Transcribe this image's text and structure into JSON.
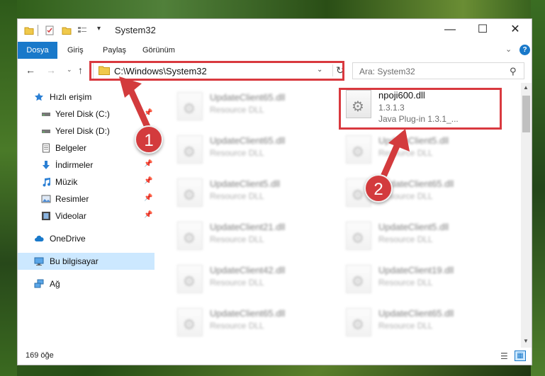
{
  "window": {
    "title": "System32",
    "controls": {
      "minimize": "—",
      "maximize": "☐",
      "close": "✕"
    }
  },
  "ribbon": {
    "tabs": [
      "Dosya",
      "Giriş",
      "Paylaş",
      "Görünüm"
    ],
    "active_tab": "Dosya",
    "help": "?"
  },
  "navigation": {
    "back": "←",
    "forward": "→",
    "history": "⌄",
    "up": "↑",
    "address": "C:\\Windows\\System32",
    "search_placeholder": "Ara: System32"
  },
  "sidebar": {
    "items": [
      {
        "label": "Hızlı erişim",
        "icon": "star-icon"
      },
      {
        "label": "Yerel Disk (C:)",
        "icon": "drive-icon",
        "pinned": true
      },
      {
        "label": "Yerel Disk (D:)",
        "icon": "drive-icon"
      },
      {
        "label": "Belgeler",
        "icon": "documents-icon"
      },
      {
        "label": "İndirmeler",
        "icon": "downloads-icon",
        "pinned": true
      },
      {
        "label": "Müzik",
        "icon": "music-icon",
        "pinned": true
      },
      {
        "label": "Resimler",
        "icon": "pictures-icon",
        "pinned": true
      },
      {
        "label": "Videolar",
        "icon": "videos-icon",
        "pinned": true
      },
      {
        "label": "OneDrive",
        "icon": "cloud-icon"
      },
      {
        "label": "Bu bilgisayar",
        "icon": "computer-icon",
        "selected": true
      },
      {
        "label": "Ağ",
        "icon": "network-icon"
      }
    ]
  },
  "files": {
    "highlighted": {
      "name": "npoji600.dll",
      "version": "1.3.1.3",
      "description": "Java Plug-in 1.3.1_..."
    },
    "left_column": [
      {
        "name": "UpdateClient65.dll",
        "type": "Resource DLL"
      },
      {
        "name": "UpdateClient65.dll",
        "type": "Resource DLL"
      },
      {
        "name": "UpdateClient5.dll",
        "type": "Resource DLL"
      },
      {
        "name": "UpdateClient21.dll",
        "type": "Resource DLL"
      },
      {
        "name": "UpdateClient42.dll",
        "type": "Resource DLL"
      },
      {
        "name": "UpdateClient65.dll",
        "type": "Resource DLL"
      }
    ],
    "right_column": [
      {
        "name": "UpdateClient5.dll",
        "type": "Resource DLL"
      },
      {
        "name": "UpdateClient65.dll",
        "type": "Resource DLL"
      },
      {
        "name": "UpdateClient5.dll",
        "type": "Resource DLL"
      },
      {
        "name": "UpdateClient19.dll",
        "type": "Resource DLL"
      },
      {
        "name": "UpdateClient65.dll",
        "type": "Resource DLL"
      }
    ]
  },
  "status": {
    "item_count": "169 öğe"
  },
  "annotations": {
    "step1": "1",
    "step2": "2",
    "highlight_color": "#d9393f",
    "badge_color": "#d33b3d"
  },
  "colors": {
    "accent": "#1979ca",
    "selection": "#cce8ff"
  }
}
